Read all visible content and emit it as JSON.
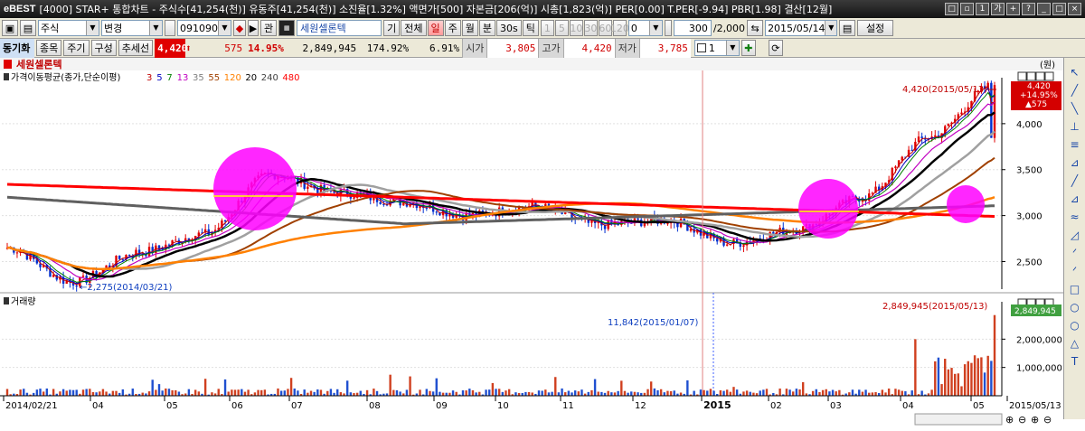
{
  "window": {
    "logo": "eBEST",
    "title": "[4000] STAR+ 통합차트 - 주식수[41,254(천)] 유동주[41,254(천)] 소진율[1.32%] 액면가[500] 자본금[206(억)] 시총[1,823(억)] PER[0.00] T.PER[-9.94] PBR[1.98] 결산[12월]",
    "buttons": [
      "□",
      "▫",
      "1",
      "가",
      "+",
      "?",
      "_",
      "□",
      "×"
    ]
  },
  "toolbar": {
    "market_select": "주식",
    "change_select": "변경",
    "code": "091090",
    "related_btn": "관",
    "stock_name": "세원셀론텍",
    "period_buttons": [
      "기",
      "전체",
      "일",
      "주",
      "월",
      "분",
      "30s",
      "틱"
    ],
    "active_period": "일",
    "minute_values": [
      "1",
      "5",
      "10",
      "30",
      "60",
      "120"
    ],
    "tick_value": "0",
    "count_value": "300",
    "total_value": "/2,000",
    "date": "2015/05/14",
    "settings_btn": "설정"
  },
  "toolbar2": {
    "sync_label": "동기화",
    "buttons": [
      "종목",
      "주기",
      "구성",
      "추세선"
    ],
    "price": "4,420",
    "change": "575",
    "change_pct": "14.95%",
    "volume": "2,849,945",
    "vol_ratio": "174.92%",
    "turnover": "6.91%",
    "open_label": "시가",
    "open": "3,805",
    "high_label": "고가",
    "high": "4,420",
    "low_label": "저가",
    "low": "3,785",
    "split_value": "1"
  },
  "price_panel": {
    "stock_label": "세원셀론텍",
    "unit_label": "(원)",
    "ma_title": "가격이동평균(종가,단순이평)",
    "ma_periods": [
      "3",
      "5",
      "7",
      "13",
      "35",
      "55",
      "120",
      "20",
      "240",
      "480"
    ],
    "ma_colors": [
      "#c00000",
      "#0000c0",
      "#008000",
      "#c000c0",
      "#808080",
      "#a04000",
      "#ff8000",
      "#000000",
      "#404040",
      "#ff0000"
    ],
    "y_labels": [
      "4,000",
      "3,500",
      "3,000",
      "2,500"
    ],
    "y_values": [
      4000,
      3500,
      3000,
      2500
    ],
    "high_annotation": "4,420(2015/05/13)",
    "low_annotation": "2,275(2014/03/21)",
    "last_price": "4,420",
    "last_change_pct": "+14.95%",
    "last_change": "▲575"
  },
  "volume_panel": {
    "title": "거래량",
    "y_labels": [
      "2,000,000",
      "1,000,000"
    ],
    "y_values": [
      2000000,
      1000000
    ],
    "max_annotation": "2,849,945(2015/05/13)",
    "min_annotation": "11,842(2015/01/07)",
    "last_volume": "2,849,945"
  },
  "x_axis": {
    "labels": [
      "2014/02/21",
      "04",
      "05",
      "06",
      "07",
      "08",
      "09",
      "10",
      "11",
      "12",
      "2015",
      "02",
      "03",
      "04",
      "05",
      "2015/05/13"
    ]
  },
  "chart_data": {
    "type": "line",
    "title": "세원셀론텍",
    "y_range": [
      2200,
      4500
    ],
    "series": [
      {
        "name": "종가",
        "x": [
          "2014/02/21",
          "2014/03/21",
          "2014/04",
          "2014/05",
          "2014/06",
          "2014/07",
          "2014/08",
          "2014/09",
          "2014/10",
          "2014/11",
          "2014/12",
          "2015/01",
          "2015/02",
          "2015/03",
          "2015/04",
          "2015/05/13"
        ],
        "values": [
          2650,
          2275,
          2600,
          2800,
          3450,
          3250,
          3150,
          3000,
          3100,
          2900,
          2950,
          2700,
          2850,
          3200,
          3850,
          4420
        ]
      }
    ],
    "volume": {
      "max": 2849945,
      "max_date": "2015/05/13",
      "min": 11842,
      "min_date": "2015/01/07"
    }
  },
  "tools": [
    "↖",
    "╱",
    "╲",
    "⊥",
    "≡",
    "⊿",
    "╱",
    "⊿",
    "≈",
    "◿",
    "ᐟ",
    "ᐟ",
    "□",
    "○",
    "○",
    "△",
    "T"
  ]
}
